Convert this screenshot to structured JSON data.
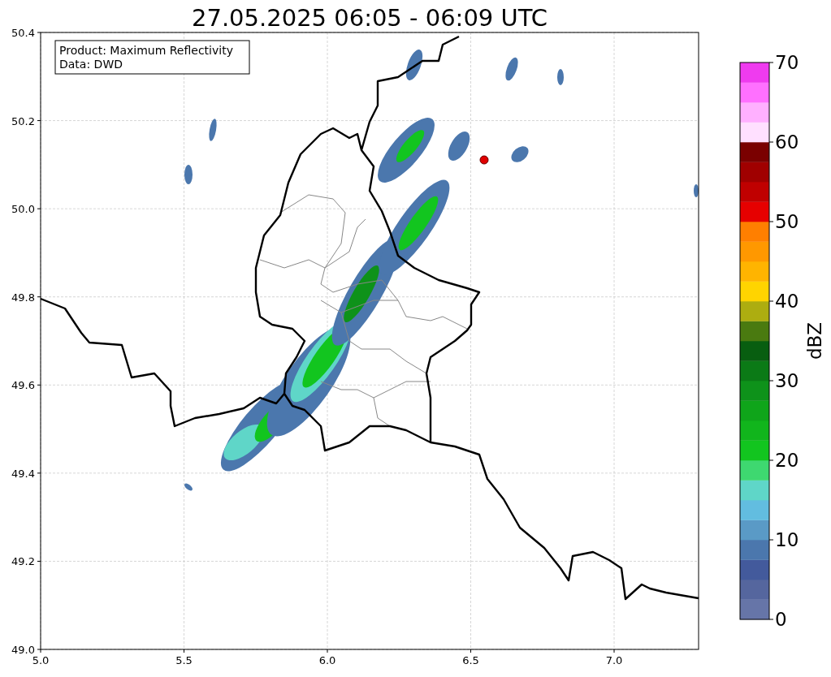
{
  "title": "27.05.2025 06:05 - 06:09 UTC",
  "annotation": [
    "Product: Maximum Reflectivity",
    "Data: DWD"
  ],
  "x_axis": {
    "ticks": [
      "5.0",
      "5.5",
      "6.0",
      "6.5",
      "7.0"
    ]
  },
  "y_axis": {
    "ticks": [
      "50.4",
      "50.2",
      "50.0",
      "49.8",
      "49.6",
      "49.4",
      "49.2",
      "49.0"
    ]
  },
  "colorbar": {
    "label": "dBZ",
    "ticks": [
      "70",
      "60",
      "50",
      "40",
      "30",
      "20",
      "10",
      "0"
    ],
    "steps": [
      {
        "color": "#6675a8"
      },
      {
        "color": "#55669e"
      },
      {
        "color": "#435a9c"
      },
      {
        "color": "#4b77ad"
      },
      {
        "color": "#5a9ac6"
      },
      {
        "color": "#62bde0"
      },
      {
        "color": "#5fd6c8"
      },
      {
        "color": "#3ed870"
      },
      {
        "color": "#12c51f"
      },
      {
        "color": "#11b51c"
      },
      {
        "color": "#0fa51a"
      },
      {
        "color": "#0e921a"
      },
      {
        "color": "#0b7a16"
      },
      {
        "color": "#085e10"
      },
      {
        "color": "#4a7a10"
      },
      {
        "color": "#adad10"
      },
      {
        "color": "#ffd400"
      },
      {
        "color": "#ffb400"
      },
      {
        "color": "#ff9800"
      },
      {
        "color": "#ff7f00"
      },
      {
        "color": "#e60000"
      },
      {
        "color": "#c00000"
      },
      {
        "color": "#a00000"
      },
      {
        "color": "#7a0000"
      },
      {
        "color": "#ffe0ff"
      },
      {
        "color": "#ffb0ff"
      },
      {
        "color": "#ff70ff"
      },
      {
        "color": "#ef3bef"
      }
    ]
  }
}
